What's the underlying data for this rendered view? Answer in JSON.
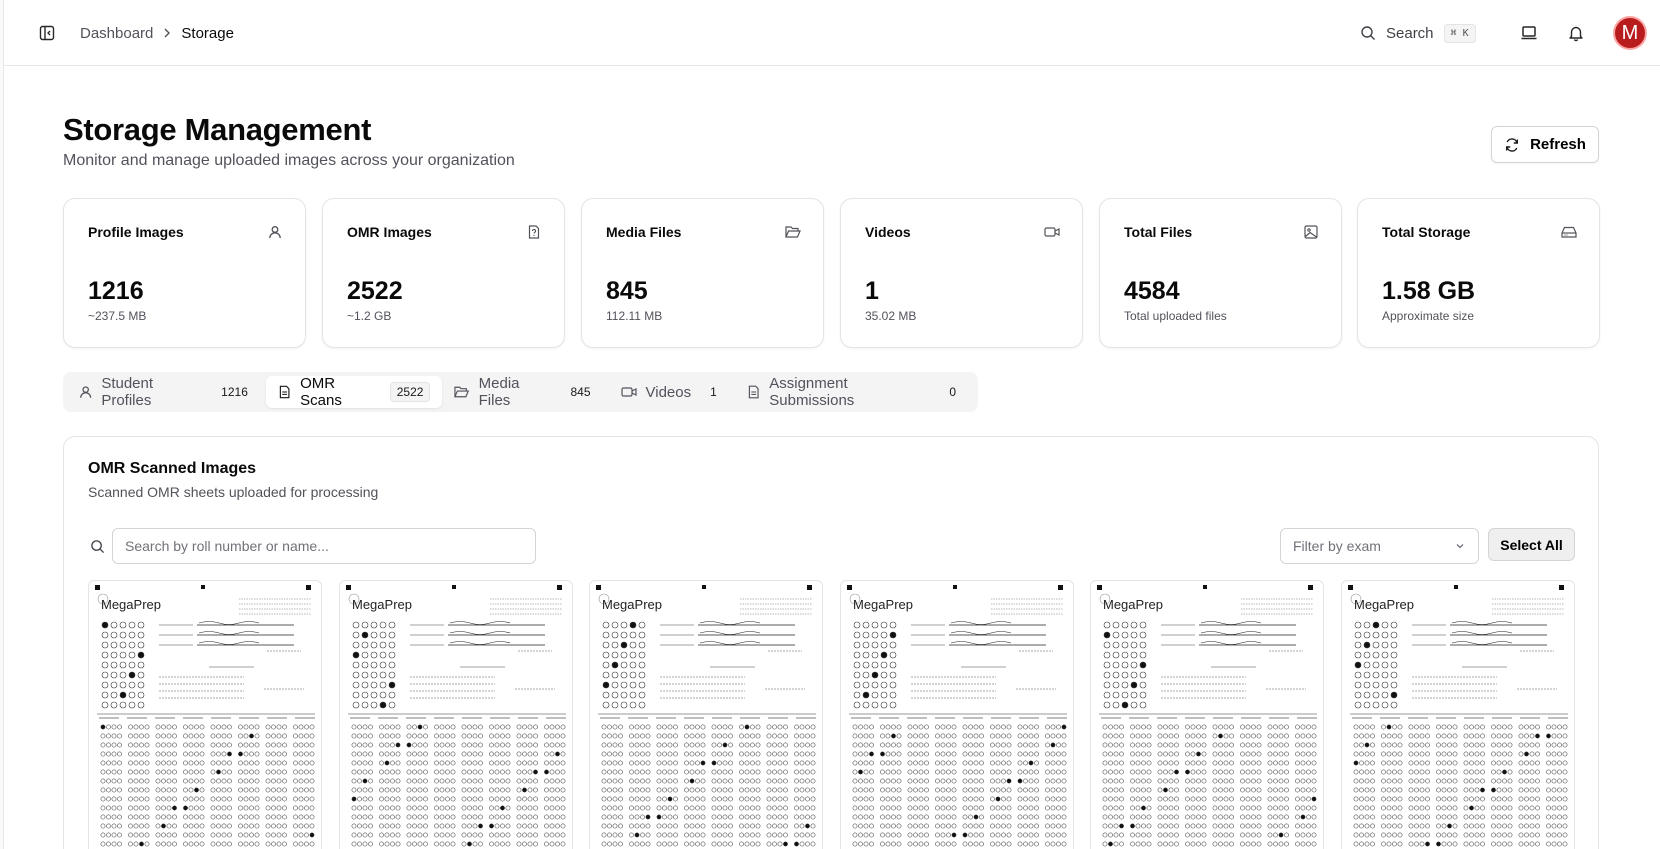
{
  "breadcrumb": {
    "parent": "Dashboard",
    "current": "Storage"
  },
  "header": {
    "search_label": "Search",
    "search_shortcut": "⌘ K",
    "avatar_initial": "M"
  },
  "page": {
    "title": "Storage Management",
    "subtitle": "Monitor and manage uploaded images across your organization",
    "refresh_label": "Refresh"
  },
  "stats": [
    {
      "label": "Profile Images",
      "value": "1216",
      "sub": "~237.5 MB",
      "icon": "user-icon"
    },
    {
      "label": "OMR Images",
      "value": "2522",
      "sub": "~1.2 GB",
      "icon": "file-question-icon"
    },
    {
      "label": "Media Files",
      "value": "845",
      "sub": "112.11 MB",
      "icon": "folder-open-icon"
    },
    {
      "label": "Videos",
      "value": "1",
      "sub": "35.02 MB",
      "icon": "video-icon"
    },
    {
      "label": "Total Files",
      "value": "4584",
      "sub": "Total uploaded files",
      "icon": "image-icon"
    },
    {
      "label": "Total Storage",
      "value": "1.58 GB",
      "sub": "Approximate size",
      "icon": "hard-drive-icon"
    }
  ],
  "tabs": [
    {
      "label": "Student Profiles",
      "count": "1216",
      "icon": "user-icon",
      "active": false
    },
    {
      "label": "OMR Scans",
      "count": "2522",
      "icon": "file-text-icon",
      "active": true
    },
    {
      "label": "Media Files",
      "count": "845",
      "icon": "folder-open-icon",
      "active": false
    },
    {
      "label": "Videos",
      "count": "1",
      "icon": "video-icon",
      "active": false
    },
    {
      "label": "Assignment Submissions",
      "count": "0",
      "icon": "file-text-icon",
      "active": false
    }
  ],
  "panel": {
    "title": "OMR Scanned Images",
    "subtitle": "Scanned OMR sheets uploaded for processing",
    "search_placeholder": "Search by roll number or name...",
    "filter_placeholder": "Filter by exam",
    "select_all_label": "Select All"
  },
  "omr_thumbnails": [
    {
      "brand": "MegaPrep"
    },
    {
      "brand": "MegaPrep"
    },
    {
      "brand": "MegaPrep"
    },
    {
      "brand": "MegaPrep"
    },
    {
      "brand": "MegaPrep"
    },
    {
      "brand": "MegaPrep"
    }
  ]
}
